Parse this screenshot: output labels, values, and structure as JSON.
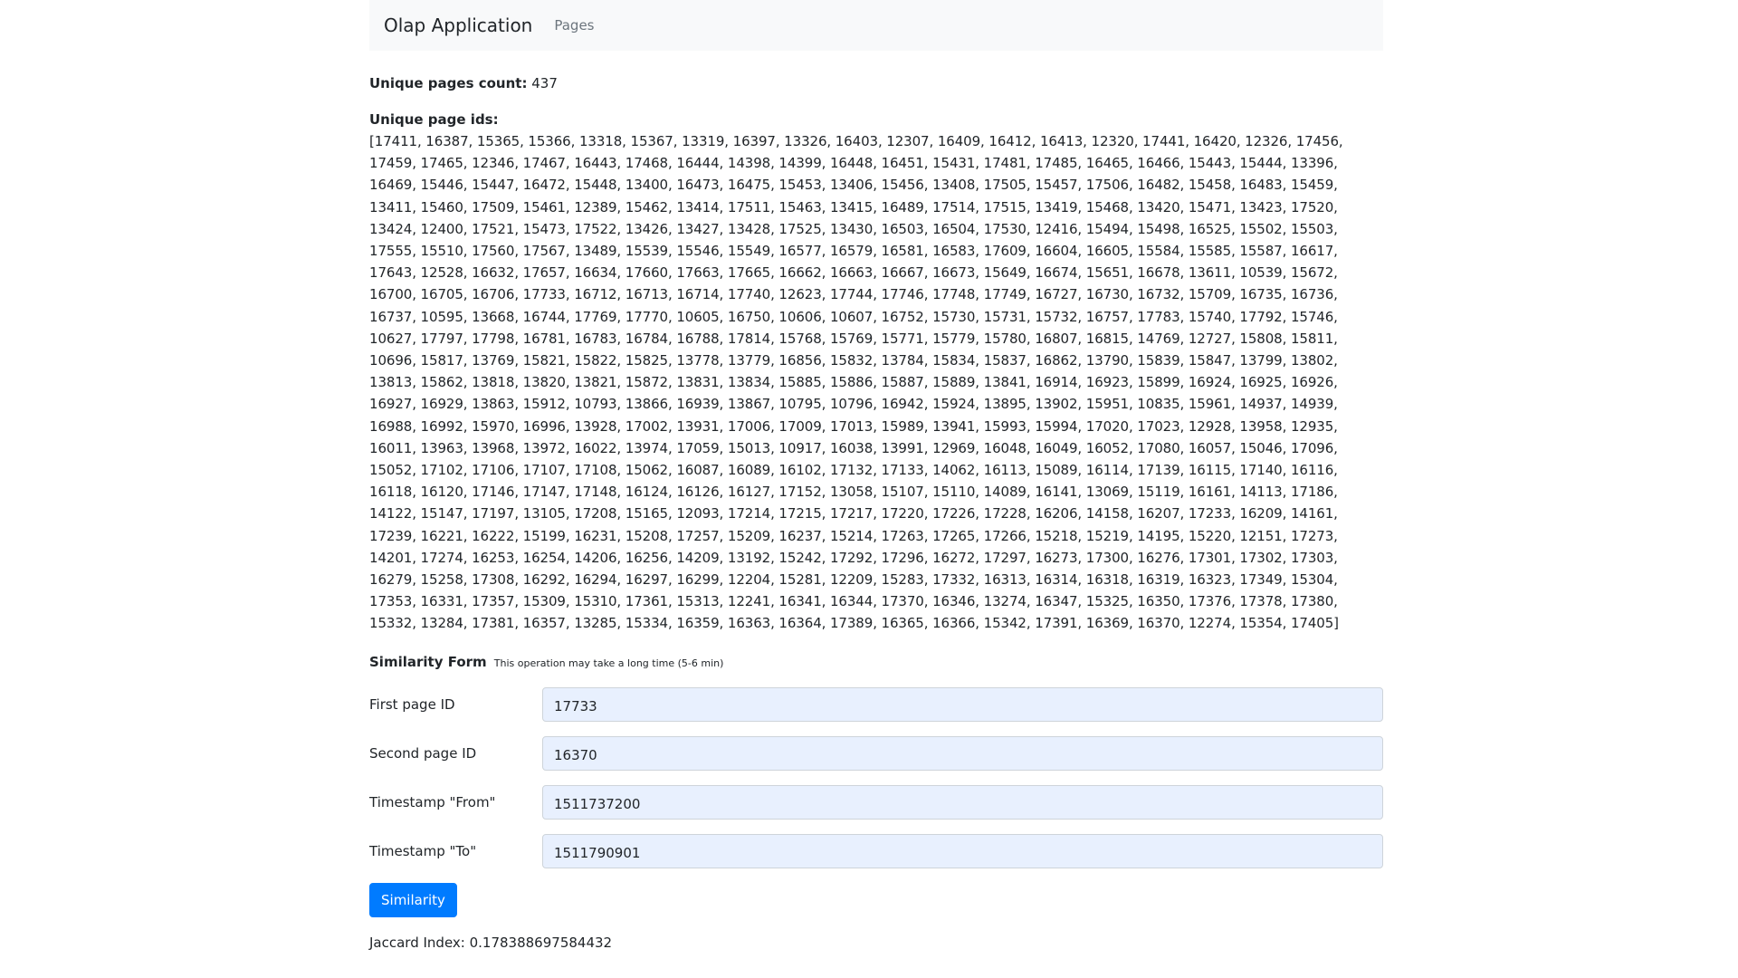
{
  "navbar": {
    "brand": "Olap Application",
    "links": [
      "Pages"
    ]
  },
  "summary": {
    "count_label": "Unique pages count:",
    "count_value": "437",
    "ids_label": "Unique page ids:",
    "ids_text": "[17411, 16387, 15365, 15366, 13318, 15367, 13319, 16397, 13326, 16403, 12307, 16409, 16412, 16413, 12320, 17441, 16420, 12326, 17456, 17459, 17465, 12346, 17467, 16443, 17468, 16444, 14398, 14399, 16448, 16451, 15431, 17481, 17485, 16465, 16466, 15443, 15444, 13396, 16469, 15446, 15447, 16472, 15448, 13400, 16473, 16475, 15453, 13406, 15456, 13408, 17505, 15457, 17506, 16482, 15458, 16483, 15459, 13411, 15460, 17509, 15461, 12389, 15462, 13414, 17511, 15463, 13415, 16489, 17514, 17515, 13419, 15468, 13420, 15471, 13423, 17520, 13424, 12400, 17521, 15473, 17522, 13426, 13427, 13428, 17525, 13430, 16503, 16504, 17530, 12416, 15494, 15498, 16525, 15502, 15503, 17555, 15510, 17560, 17567, 13489, 15539, 15546, 15549, 16577, 16579, 16581, 16583, 17609, 16604, 16605, 15584, 15585, 15587, 16617, 17643, 12528, 16632, 17657, 16634, 17660, 17663, 17665, 16662, 16663, 16667, 16673, 15649, 16674, 15651, 16678, 13611, 10539, 15672, 16700, 16705, 16706, 17733, 16712, 16713, 16714, 17740, 12623, 17744, 17746, 17748, 17749, 16727, 16730, 16732, 15709, 16735, 16736, 16737, 10595, 13668, 16744, 17769, 17770, 10605, 16750, 10606, 10607, 16752, 15730, 15731, 15732, 16757, 17783, 15740, 17792, 15746, 10627, 17797, 17798, 16781, 16783, 16784, 16788, 17814, 15768, 15769, 15771, 15779, 15780, 16807, 16815, 14769, 12727, 15808, 15811, 10696, 15817, 13769, 15821, 15822, 15825, 13778, 13779, 16856, 15832, 13784, 15834, 15837, 16862, 13790, 15839, 15847, 13799, 13802, 13813, 15862, 13818, 13820, 13821, 15872, 13831, 13834, 15885, 15886, 15887, 15889, 13841, 16914, 16923, 15899, 16924, 16925, 16926, 16927, 16929, 13863, 15912, 10793, 13866, 16939, 13867, 10795, 10796, 16942, 15924, 13895, 13902, 15951, 10835, 15961, 14937, 14939, 16988, 16992, 15970, 16996, 13928, 17002, 13931, 17006, 17009, 17013, 15989, 13941, 15993, 15994, 17020, 17023, 12928, 13958, 12935, 16011, 13963, 13968, 13972, 16022, 13974, 17059, 15013, 10917, 16038, 13991, 12969, 16048, 16049, 16052, 17080, 16057, 15046, 17096, 15052, 17102, 17106, 17107, 17108, 15062, 16087, 16089, 16102, 17132, 17133, 14062, 16113, 15089, 16114, 17139, 16115, 17140, 16116, 16118, 16120, 17146, 17147, 17148, 16124, 16126, 16127, 17152, 13058, 15107, 15110, 14089, 16141, 13069, 15119, 16161, 14113, 17186, 14122, 15147, 17197, 13105, 17208, 15165, 12093, 17214, 17215, 17217, 17220, 17226, 17228, 16206, 14158, 16207, 17233, 16209, 14161, 17239, 16221, 16222, 15199, 16231, 15208, 17257, 15209, 16237, 15214, 17263, 17265, 17266, 15218, 15219, 14195, 15220, 12151, 17273, 14201, 17274, 16253, 16254, 14206, 16256, 14209, 13192, 15242, 17292, 17296, 16272, 17297, 16273, 17300, 16276, 17301, 17302, 17303, 16279, 15258, 17308, 16292, 16294, 16297, 16299, 12204, 15281, 12209, 15283, 17332, 16313, 16314, 16318, 16319, 16323, 17349, 15304, 17353, 16331, 17357, 15309, 15310, 17361, 15313, 12241, 16341, 16344, 17370, 16346, 13274, 16347, 15325, 16350, 17376, 17378, 17380, 15332, 13284, 17381, 16357, 13285, 15334, 16359, 16363, 16364, 17389, 16365, 16366, 15342, 17391, 16369, 16370, 12274, 15354, 17405]"
  },
  "similarity_form": {
    "title": "Similarity Form",
    "hint": "This operation may take a long time (5-6 min)",
    "fields": [
      {
        "label": "First page ID",
        "value": "17733"
      },
      {
        "label": "Second page ID",
        "value": "16370"
      },
      {
        "label": "Timestamp \"From\"",
        "value": "1511737200"
      },
      {
        "label": "Timestamp \"To\"",
        "value": "1511790901"
      }
    ],
    "submit_label": "Similarity",
    "result_text": "Jaccard Index: 0.178388697584432"
  }
}
